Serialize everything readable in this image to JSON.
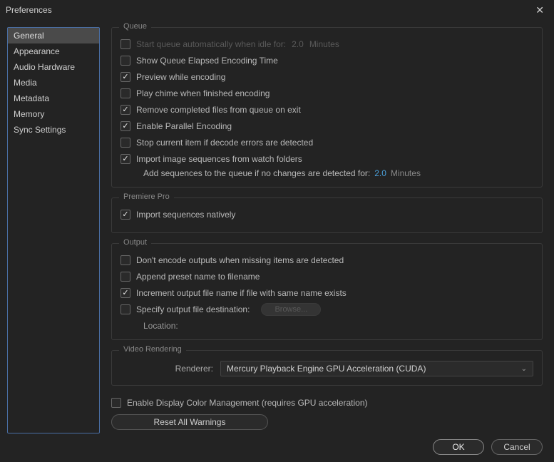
{
  "window": {
    "title": "Preferences"
  },
  "sidebar": {
    "items": [
      {
        "label": "General",
        "selected": true
      },
      {
        "label": "Appearance",
        "selected": false
      },
      {
        "label": "Audio Hardware",
        "selected": false
      },
      {
        "label": "Media",
        "selected": false
      },
      {
        "label": "Metadata",
        "selected": false
      },
      {
        "label": "Memory",
        "selected": false
      },
      {
        "label": "Sync Settings",
        "selected": false
      }
    ]
  },
  "groups": {
    "queue": {
      "title": "Queue",
      "start_auto": {
        "label": "Start queue automatically when idle for:",
        "checked": false,
        "value": "2.0",
        "unit": "Minutes"
      },
      "show_elapsed": {
        "label": "Show Queue Elapsed Encoding Time",
        "checked": false
      },
      "preview": {
        "label": "Preview while encoding",
        "checked": true
      },
      "chime": {
        "label": "Play chime when finished encoding",
        "checked": false
      },
      "remove_completed": {
        "label": "Remove completed files from queue on exit",
        "checked": true
      },
      "parallel": {
        "label": "Enable Parallel Encoding",
        "checked": true
      },
      "stop_decode_err": {
        "label": "Stop current item if decode errors are detected",
        "checked": false
      },
      "import_watch": {
        "label": "Import image sequences from watch folders",
        "checked": true
      },
      "add_seq": {
        "label": "Add sequences to the queue if no changes are detected for:",
        "value": "2.0",
        "unit": "Minutes"
      }
    },
    "premiere": {
      "title": "Premiere Pro",
      "import_native": {
        "label": "Import sequences natively",
        "checked": true
      }
    },
    "output": {
      "title": "Output",
      "dont_encode_missing": {
        "label": "Don't encode outputs when missing items are detected",
        "checked": false
      },
      "append_preset": {
        "label": "Append preset name to filename",
        "checked": false
      },
      "increment": {
        "label": "Increment output file name if file with same name exists",
        "checked": true
      },
      "specify_dest": {
        "label": "Specify output file destination:",
        "checked": false,
        "browse": "Browse..."
      },
      "location_label": "Location:",
      "location_value": ""
    },
    "video_rendering": {
      "title": "Video Rendering",
      "renderer_label": "Renderer:",
      "renderer_value": "Mercury Playback Engine GPU Acceleration (CUDA)"
    }
  },
  "color_mgmt": {
    "label": "Enable Display Color Management (requires GPU acceleration)",
    "checked": false
  },
  "reset_warnings": "Reset All Warnings",
  "buttons": {
    "ok": "OK",
    "cancel": "Cancel"
  }
}
